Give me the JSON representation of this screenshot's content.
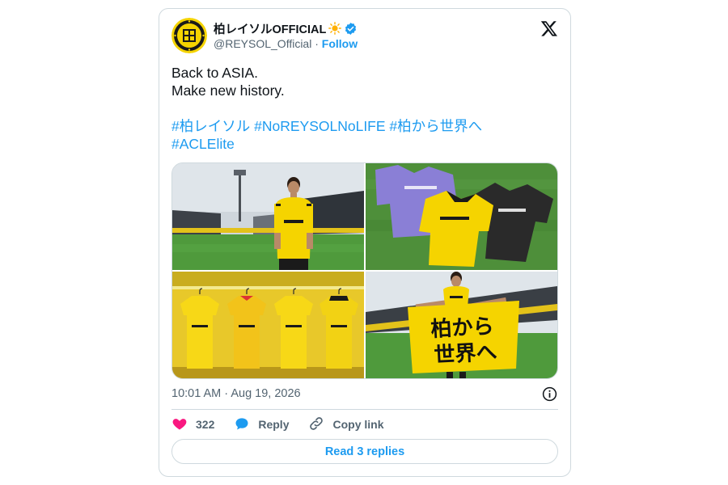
{
  "account": {
    "display_name": "柏レイソルOFFICIAL",
    "handle": "@REYSOL_Official",
    "separator": "·",
    "follow_label": "Follow"
  },
  "tweet": {
    "line1": "Back to ASIA.",
    "line2": "Make new history.",
    "hashtags_line1": [
      "#柏レイソル",
      "#NoREYSOLNoLIFE",
      "#柏から世界へ"
    ],
    "hashtags_line2": [
      "#ACLElite"
    ]
  },
  "media": {
    "photo4_flag_text_line1": "柏から",
    "photo4_flag_text_line2": "世界へ"
  },
  "meta": {
    "timestamp": "10:01 AM · Aug 19, 2026"
  },
  "actions": {
    "like_count": "322",
    "reply_label": "Reply",
    "copy_label": "Copy link"
  },
  "footer": {
    "read_replies_label": "Read 3 replies"
  },
  "icons": {
    "avatar": "club-crest-icon",
    "sun": "sun-icon",
    "verified": "verified-badge-icon",
    "x_logo": "x-logo-icon",
    "info": "info-icon",
    "like": "heart-icon",
    "reply": "reply-bubble-icon",
    "copy": "link-icon"
  },
  "colors": {
    "accent_blue": "#1d9bf0",
    "like_pink": "#f91880",
    "club_yellow": "#f5d400",
    "text_primary": "#0f1419",
    "text_secondary": "#536471",
    "border": "#cfd9de"
  }
}
